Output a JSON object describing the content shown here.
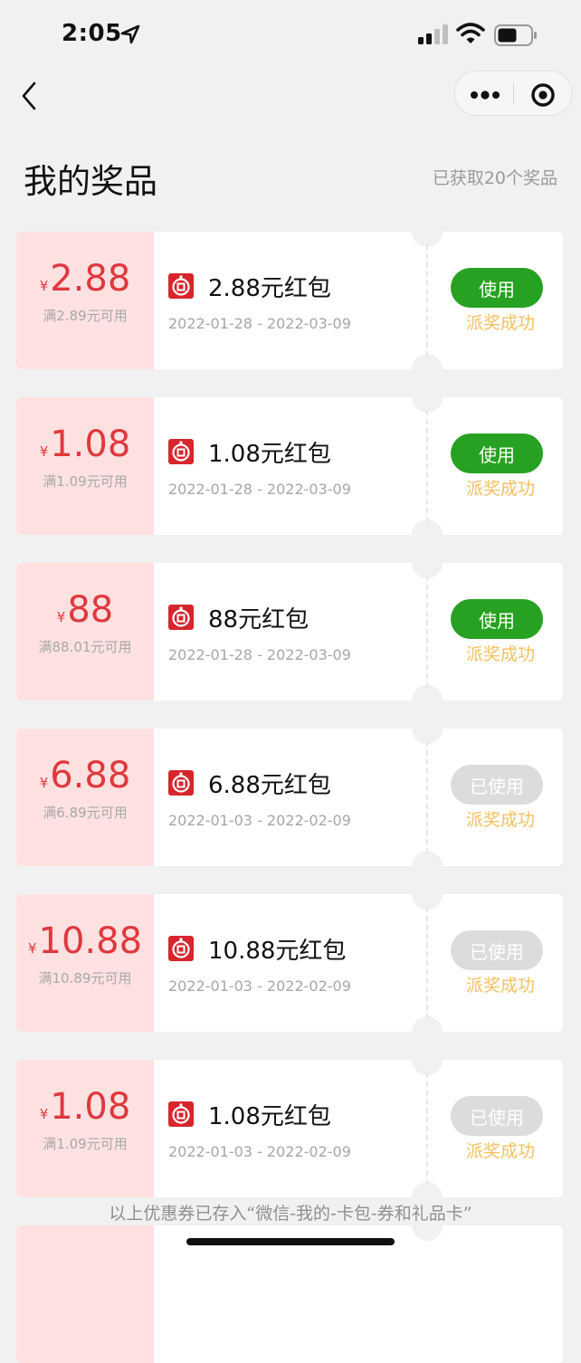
{
  "status_bar": {
    "time": "2:05"
  },
  "header": {
    "title": "我的奖品",
    "count_text": "已获取20个奖品"
  },
  "prizes": [
    {
      "amount": "2.88",
      "threshold": "满2.89元可用",
      "title": "2.88元红包",
      "validity": "2022-01-28 - 2022-03-09",
      "button": "使用",
      "state": "active",
      "status": "派奖成功"
    },
    {
      "amount": "1.08",
      "threshold": "满1.09元可用",
      "title": "1.08元红包",
      "validity": "2022-01-28 - 2022-03-09",
      "button": "使用",
      "state": "active",
      "status": "派奖成功"
    },
    {
      "amount": "88",
      "threshold": "满88.01元可用",
      "title": "88元红包",
      "validity": "2022-01-28 - 2022-03-09",
      "button": "使用",
      "state": "active",
      "status": "派奖成功"
    },
    {
      "amount": "6.88",
      "threshold": "满6.89元可用",
      "title": "6.88元红包",
      "validity": "2022-01-03 - 2022-02-09",
      "button": "已使用",
      "state": "used",
      "status": "派奖成功"
    },
    {
      "amount": "10.88",
      "threshold": "满10.89元可用",
      "title": "10.88元红包",
      "validity": "2022-01-03 - 2022-02-09",
      "button": "已使用",
      "state": "used",
      "status": "派奖成功"
    },
    {
      "amount": "1.08",
      "threshold": "满1.09元可用",
      "title": "1.08元红包",
      "validity": "2022-01-03 - 2022-02-09",
      "button": "已使用",
      "state": "used",
      "status": "派奖成功"
    }
  ],
  "currency_symbol": "¥",
  "footer_note": "以上优惠券已存入“微信-我的-卡包-券和礼品卡”",
  "colors": {
    "accent_red": "#e0383e",
    "use_green": "#27a121",
    "status_yellow": "#f5c061",
    "coupon_pink": "#ffe1e1"
  }
}
